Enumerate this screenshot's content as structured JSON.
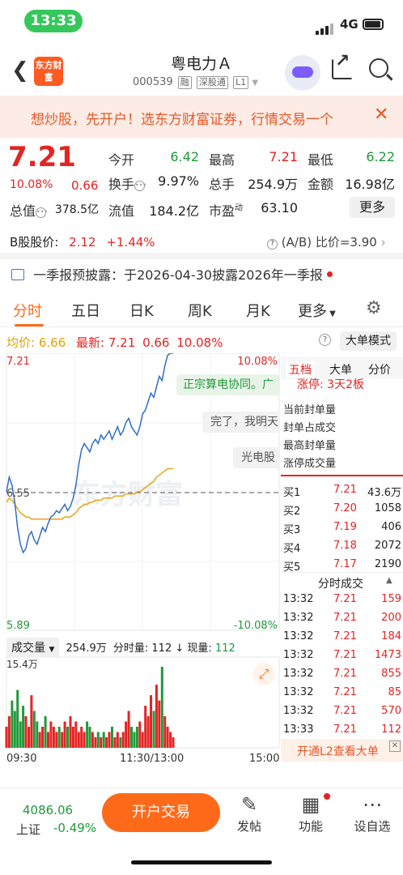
{
  "status_bar": {
    "time": "13:33",
    "network": "4G"
  },
  "header": {
    "logo_text": "东方财富",
    "title": "粤电力Ａ",
    "code": "000539",
    "tags": [
      "融",
      "深股通",
      "L1"
    ]
  },
  "banner": {
    "text": "想炒股，先开户！选东方财富证券，行情交易一个"
  },
  "quote": {
    "price": "7.21",
    "change_pct": "10.08%",
    "change": "0.66",
    "items": [
      {
        "label": "今开",
        "value": "6.42",
        "color": "green"
      },
      {
        "label": "最高",
        "value": "7.21",
        "color": "red"
      },
      {
        "label": "最低",
        "value": "6.22",
        "color": "green"
      },
      {
        "label": "换手",
        "value": "9.97%",
        "color": "black"
      },
      {
        "label": "总手",
        "value": "254.9万",
        "color": "black"
      },
      {
        "label": "金额",
        "value": "16.98亿",
        "color": "black"
      },
      {
        "label": "总值",
        "value": "378.5亿",
        "color": "black"
      },
      {
        "label": "流值",
        "value": "184.2亿",
        "color": "black"
      },
      {
        "label": "市盈",
        "value": "63.10",
        "color": "black"
      }
    ],
    "dyn_label": "动",
    "more": "更多"
  },
  "bshare": {
    "label": "B股股价:",
    "price": "2.12",
    "pct": "+1.44%",
    "ratio_label": "(A/B) 比价=3.90"
  },
  "notice": {
    "text": "一季报预披露：于2026-04-30披露2026年一季报"
  },
  "tabs": [
    "分时",
    "五日",
    "日K",
    "周K",
    "月K",
    "更多"
  ],
  "intraday": {
    "avg_label": "均价:",
    "avg": "6.66",
    "latest_label": "最新:",
    "latest": "7.21",
    "chg": "0.66",
    "pct": "10.08%",
    "bigorder_btn": "大单模式",
    "y_top": "7.21",
    "y_mid": "6.55",
    "y_bottom": "5.89",
    "pct_top": "10.08%",
    "pct_bottom": "-10.08%",
    "watermark": "东方财富",
    "bubbles": [
      "正宗算电协同。广",
      "完了，我明天",
      "光电股"
    ]
  },
  "chart_data": {
    "type": "line",
    "title": "",
    "ylim": [
      5.89,
      7.21
    ],
    "prev_close": 6.55,
    "price": [
      6.55,
      6.62,
      6.58,
      6.5,
      6.38,
      6.3,
      6.26,
      6.28,
      6.34,
      6.36,
      6.32,
      6.3,
      6.34,
      6.38,
      6.36,
      6.4,
      6.43,
      6.44,
      6.46,
      6.45,
      6.47,
      6.49,
      6.46,
      6.48,
      6.52,
      6.58,
      6.68,
      6.75,
      6.78,
      6.76,
      6.74,
      6.78,
      6.8,
      6.78,
      6.82,
      6.8,
      6.82,
      6.84,
      6.8,
      6.83,
      6.86,
      6.82,
      6.84,
      6.88,
      6.9,
      6.86,
      6.84,
      6.82,
      6.86,
      6.92,
      6.94,
      6.98,
      7.02,
      7.0,
      7.05,
      7.1,
      7.08,
      7.15,
      7.2,
      7.21,
      7.21
    ],
    "avg": [
      6.5,
      6.52,
      6.51,
      6.49,
      6.47,
      6.45,
      6.44,
      6.43,
      6.43,
      6.42,
      6.42,
      6.42,
      6.42,
      6.42,
      6.42,
      6.42,
      6.42,
      6.42,
      6.42,
      6.42,
      6.42,
      6.43,
      6.43,
      6.43,
      6.44,
      6.45,
      6.47,
      6.48,
      6.49,
      6.49,
      6.5,
      6.5,
      6.51,
      6.51,
      6.51,
      6.52,
      6.52,
      6.52,
      6.52,
      6.53,
      6.53,
      6.53,
      6.53,
      6.54,
      6.54,
      6.54,
      6.54,
      6.55,
      6.55,
      6.56,
      6.57,
      6.58,
      6.59,
      6.6,
      6.62,
      6.63,
      6.64,
      6.65,
      6.66,
      6.66,
      6.66
    ],
    "volume_max_label": "15.4万",
    "volume": [
      4,
      6,
      9,
      7,
      11,
      5,
      8,
      6,
      4,
      10,
      7,
      5,
      3,
      4,
      6,
      3,
      5,
      4,
      3,
      4,
      3,
      5,
      4,
      6,
      4,
      5,
      3,
      4,
      3,
      5,
      4,
      3,
      2,
      3,
      2,
      3,
      2,
      3,
      4,
      2,
      3,
      2,
      3,
      5,
      7,
      4,
      3,
      4,
      5,
      3,
      8,
      6,
      10,
      7,
      12,
      9,
      15.4,
      6,
      4,
      3,
      2
    ],
    "x_ticks": [
      "09:30",
      "11:30/13:00",
      "15:00"
    ]
  },
  "volume_bar": {
    "select": "成交量",
    "total": "254.9万",
    "min_label": "分时量:",
    "min_val": "112",
    "now_label": "现量:",
    "now_val": "112"
  },
  "orderbook": {
    "tabs": [
      "五档",
      "大单",
      "分价"
    ],
    "limit_label": "涨停:",
    "limit_val": "3天2板",
    "stats": [
      "当前封单量",
      "封单占成交",
      "最高封单量",
      "涨停成交量"
    ],
    "bids": [
      {
        "name": "买1",
        "price": "7.21",
        "vol": "43.6万"
      },
      {
        "name": "买2",
        "price": "7.20",
        "vol": "1058"
      },
      {
        "name": "买3",
        "price": "7.19",
        "vol": "406"
      },
      {
        "name": "买4",
        "price": "7.18",
        "vol": "2072"
      },
      {
        "name": "买5",
        "price": "7.17",
        "vol": "2190"
      }
    ],
    "trades_title": "分时成交",
    "trades": [
      {
        "time": "13:32",
        "price": "7.21",
        "vol": "159"
      },
      {
        "time": "13:32",
        "price": "7.21",
        "vol": "200"
      },
      {
        "time": "13:32",
        "price": "7.21",
        "vol": "184"
      },
      {
        "time": "13:32",
        "price": "7.21",
        "vol": "1473"
      },
      {
        "time": "13:32",
        "price": "7.21",
        "vol": "855"
      },
      {
        "time": "13:32",
        "price": "7.21",
        "vol": "85"
      },
      {
        "time": "13:32",
        "price": "7.21",
        "vol": "570"
      },
      {
        "time": "13:33",
        "price": "7.21",
        "vol": "112"
      }
    ],
    "l2_text": "开通L2查看大单"
  },
  "bottom": {
    "index_value": "4086.06",
    "index_name": "上证",
    "index_change": "-0.49%",
    "open_account": "开户交易",
    "post": "发帖",
    "functions": "功能",
    "customize": "设自选"
  }
}
